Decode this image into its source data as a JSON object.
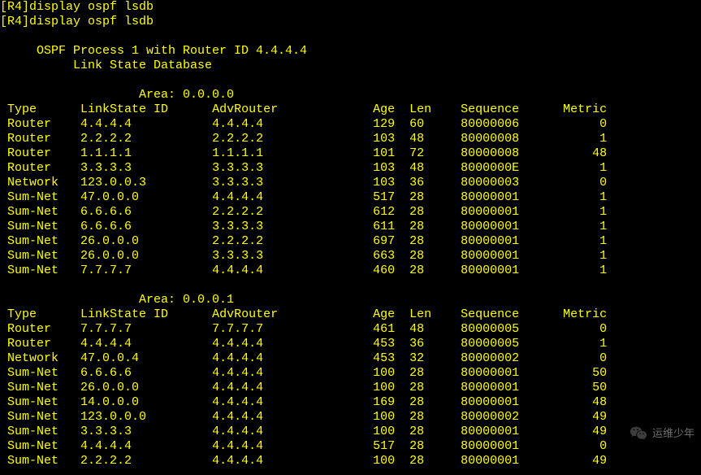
{
  "top_partial": "[R4]display ospf lsdb",
  "command": {
    "prompt": "[R4]",
    "text": "display ospf lsdb"
  },
  "banner": {
    "line1": "OSPF Process 1 with Router ID 4.4.4.4",
    "line2": "Link State Database"
  },
  "areas": [
    {
      "title": "Area: 0.0.0.0",
      "headers": {
        "type": "Type",
        "lsid": "LinkState ID",
        "adv": "AdvRouter",
        "age": "Age",
        "len": "Len",
        "seq": "Sequence",
        "metric": "Metric"
      },
      "rows": [
        {
          "type": "Router",
          "lsid": "4.4.4.4",
          "adv": "4.4.4.4",
          "age": "129",
          "len": "60",
          "seq": "80000006",
          "metric": "0"
        },
        {
          "type": "Router",
          "lsid": "2.2.2.2",
          "adv": "2.2.2.2",
          "age": "103",
          "len": "48",
          "seq": "80000008",
          "metric": "1"
        },
        {
          "type": "Router",
          "lsid": "1.1.1.1",
          "adv": "1.1.1.1",
          "age": "101",
          "len": "72",
          "seq": "80000008",
          "metric": "48"
        },
        {
          "type": "Router",
          "lsid": "3.3.3.3",
          "adv": "3.3.3.3",
          "age": "103",
          "len": "48",
          "seq": "8000000E",
          "metric": "1"
        },
        {
          "type": "Network",
          "lsid": "123.0.0.3",
          "adv": "3.3.3.3",
          "age": "103",
          "len": "36",
          "seq": "80000003",
          "metric": "0"
        },
        {
          "type": "Sum-Net",
          "lsid": "47.0.0.0",
          "adv": "4.4.4.4",
          "age": "517",
          "len": "28",
          "seq": "80000001",
          "metric": "1"
        },
        {
          "type": "Sum-Net",
          "lsid": "6.6.6.6",
          "adv": "2.2.2.2",
          "age": "612",
          "len": "28",
          "seq": "80000001",
          "metric": "1"
        },
        {
          "type": "Sum-Net",
          "lsid": "6.6.6.6",
          "adv": "3.3.3.3",
          "age": "611",
          "len": "28",
          "seq": "80000001",
          "metric": "1"
        },
        {
          "type": "Sum-Net",
          "lsid": "26.0.0.0",
          "adv": "2.2.2.2",
          "age": "697",
          "len": "28",
          "seq": "80000001",
          "metric": "1"
        },
        {
          "type": "Sum-Net",
          "lsid": "26.0.0.0",
          "adv": "3.3.3.3",
          "age": "663",
          "len": "28",
          "seq": "80000001",
          "metric": "1"
        },
        {
          "type": "Sum-Net",
          "lsid": "7.7.7.7",
          "adv": "4.4.4.4",
          "age": "460",
          "len": "28",
          "seq": "80000001",
          "metric": "1"
        }
      ]
    },
    {
      "title": "Area: 0.0.0.1",
      "headers": {
        "type": "Type",
        "lsid": "LinkState ID",
        "adv": "AdvRouter",
        "age": "Age",
        "len": "Len",
        "seq": "Sequence",
        "metric": "Metric"
      },
      "rows": [
        {
          "type": "Router",
          "lsid": "7.7.7.7",
          "adv": "7.7.7.7",
          "age": "461",
          "len": "48",
          "seq": "80000005",
          "metric": "0"
        },
        {
          "type": "Router",
          "lsid": "4.4.4.4",
          "adv": "4.4.4.4",
          "age": "453",
          "len": "36",
          "seq": "80000005",
          "metric": "1"
        },
        {
          "type": "Network",
          "lsid": "47.0.0.4",
          "adv": "4.4.4.4",
          "age": "453",
          "len": "32",
          "seq": "80000002",
          "metric": "0"
        },
        {
          "type": "Sum-Net",
          "lsid": "6.6.6.6",
          "adv": "4.4.4.4",
          "age": "100",
          "len": "28",
          "seq": "80000001",
          "metric": "50"
        },
        {
          "type": "Sum-Net",
          "lsid": "26.0.0.0",
          "adv": "4.4.4.4",
          "age": "100",
          "len": "28",
          "seq": "80000001",
          "metric": "50"
        },
        {
          "type": "Sum-Net",
          "lsid": "14.0.0.0",
          "adv": "4.4.4.4",
          "age": "169",
          "len": "28",
          "seq": "80000001",
          "metric": "48"
        },
        {
          "type": "Sum-Net",
          "lsid": "123.0.0.0",
          "adv": "4.4.4.4",
          "age": "100",
          "len": "28",
          "seq": "80000002",
          "metric": "49"
        },
        {
          "type": "Sum-Net",
          "lsid": "3.3.3.3",
          "adv": "4.4.4.4",
          "age": "100",
          "len": "28",
          "seq": "80000001",
          "metric": "49"
        },
        {
          "type": "Sum-Net",
          "lsid": "4.4.4.4",
          "adv": "4.4.4.4",
          "age": "517",
          "len": "28",
          "seq": "80000001",
          "metric": "0"
        },
        {
          "type": "Sum-Net",
          "lsid": "2.2.2.2",
          "adv": "4.4.4.4",
          "age": "100",
          "len": "28",
          "seq": "80000001",
          "metric": "49"
        }
      ]
    }
  ],
  "watermark": "运维少年"
}
